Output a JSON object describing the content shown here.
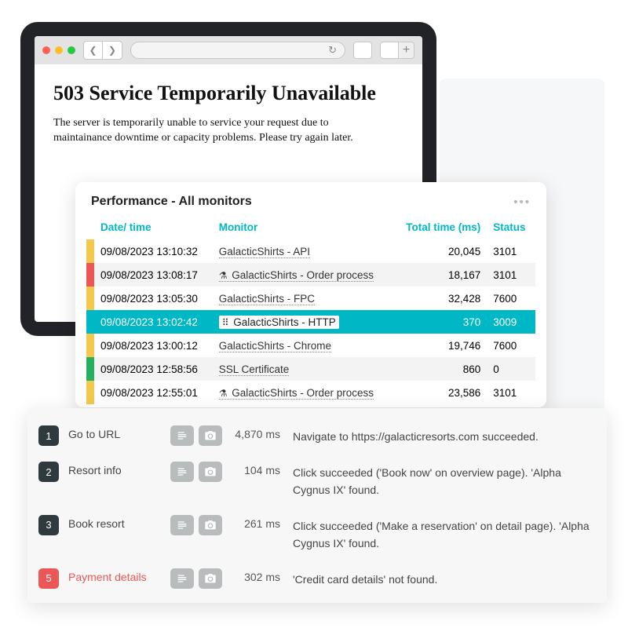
{
  "browser": {
    "error_heading": "503 Service Temporarily Unavailable",
    "error_body": "The server is temporarily unable to service your request due to maintainance downtime or capacity problems. Please try again later."
  },
  "performance": {
    "title": "Performance - All monitors",
    "columns": {
      "datetime": "Date/ time",
      "monitor": "Monitor",
      "total": "Total time (ms)",
      "status": "Status"
    },
    "rows": [
      {
        "color": "yellow",
        "datetime": "09/08/2023 13:10:32",
        "monitor": "GalacticShirts - API",
        "icon": "",
        "total": "20,045",
        "status": "3101",
        "hl": false,
        "zebra": false
      },
      {
        "color": "red",
        "datetime": "09/08/2023 13:08:17",
        "monitor": "GalacticShirts - Order process",
        "icon": "flask",
        "total": "18,167",
        "status": "3101",
        "hl": false,
        "zebra": true
      },
      {
        "color": "yellow",
        "datetime": "09/08/2023 13:05:30",
        "monitor": "GalacticShirts - FPC",
        "icon": "",
        "total": "32,428",
        "status": "7600",
        "hl": false,
        "zebra": false
      },
      {
        "color": "",
        "datetime": "09/08/2023 13:02:42",
        "monitor": "GalacticShirts - HTTP",
        "icon": "dots",
        "total": "370",
        "status": "3009",
        "hl": true,
        "zebra": true
      },
      {
        "color": "yellow",
        "datetime": "09/08/2023 13:00:12",
        "monitor": "GalacticShirts - Chrome",
        "icon": "",
        "total": "19,746",
        "status": "7600",
        "hl": false,
        "zebra": false
      },
      {
        "color": "green",
        "datetime": "09/08/2023 12:58:56",
        "monitor": "SSL Certificate",
        "icon": "",
        "total": "860",
        "status": "0",
        "hl": false,
        "zebra": true
      },
      {
        "color": "yellow",
        "datetime": "09/08/2023 12:55:01",
        "monitor": "GalacticShirts - Order process",
        "icon": "flask",
        "total": "23,586",
        "status": "3101",
        "hl": false,
        "zebra": false
      }
    ]
  },
  "steps": [
    {
      "num": "1",
      "name": "Go to URL",
      "ms": "4,870 ms",
      "msg": "Navigate to https://galacticresorts.com succeeded.",
      "err": false
    },
    {
      "num": "2",
      "name": "Resort info",
      "ms": "104 ms",
      "msg": "Click succeeded ('Book now' on overview page). 'Alpha Cygnus IX' found.",
      "err": false
    },
    {
      "num": "3",
      "name": "Book resort",
      "ms": "261 ms",
      "msg": "Click succeeded ('Make a reservation' on detail page). 'Alpha Cygnus IX' found.",
      "err": false
    },
    {
      "num": "5",
      "name": "Payment details",
      "ms": "302 ms",
      "msg": "'Credit card details' not found.",
      "err": true
    }
  ]
}
